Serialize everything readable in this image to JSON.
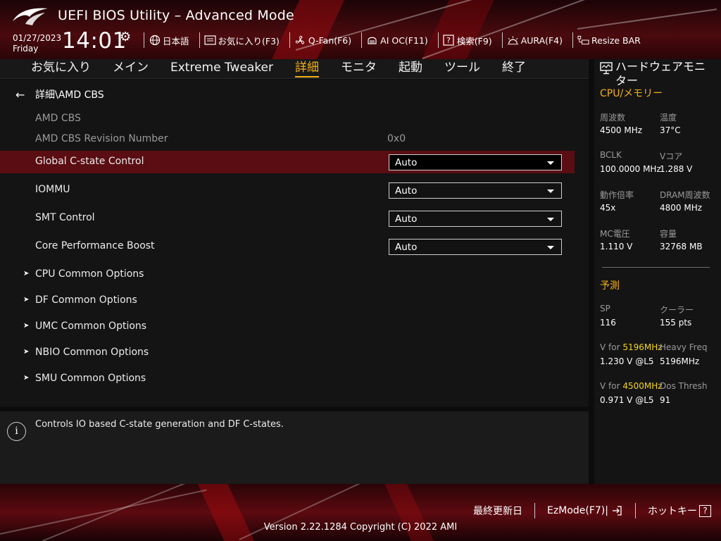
{
  "header": {
    "title": "UEFI BIOS Utility – Advanced Mode",
    "date": "01/27/2023",
    "weekday": "Friday",
    "time": "14:01",
    "toolbar": [
      {
        "label": "日本語",
        "icon": "globe-icon"
      },
      {
        "label": "お気に入り(F3)",
        "icon": "favorites-icon"
      },
      {
        "label": "Q-Fan(F6)",
        "icon": "fan-icon"
      },
      {
        "label": "AI OC(F11)",
        "icon": "ai-oc-icon"
      },
      {
        "label": "検索(F9)",
        "icon": "help-search-icon"
      },
      {
        "label": "AURA(F4)",
        "icon": "aura-icon"
      },
      {
        "label": "Resize BAR",
        "icon": "resize-bar-icon"
      }
    ]
  },
  "tabs": [
    {
      "label": "お気に入り",
      "active": false
    },
    {
      "label": "メイン",
      "active": false
    },
    {
      "label": "Extreme Tweaker",
      "active": false
    },
    {
      "label": "詳細",
      "active": true
    },
    {
      "label": "モニタ",
      "active": false
    },
    {
      "label": "起動",
      "active": false
    },
    {
      "label": "ツール",
      "active": false
    },
    {
      "label": "終了",
      "active": false
    }
  ],
  "main": {
    "breadcrumb": "詳細\\AMD CBS",
    "section_title": "AMD CBS",
    "revision_label": "AMD CBS Revision Number",
    "revision_value": "0x0",
    "settings": [
      {
        "label": "Global C-state Control",
        "value": "Auto",
        "selected": true
      },
      {
        "label": "IOMMU",
        "value": "Auto",
        "selected": false
      },
      {
        "label": "SMT Control",
        "value": "Auto",
        "selected": false
      },
      {
        "label": "Core Performance Boost",
        "value": "Auto",
        "selected": false
      }
    ],
    "submenus": [
      "CPU Common Options",
      "DF Common Options",
      "UMC Common Options",
      "NBIO Common Options",
      "SMU Common Options"
    ]
  },
  "help": {
    "text": "Controls IO based C-state generation and DF C-states."
  },
  "hw_monitor": {
    "title": "ハードウェアモニター",
    "cpu_section": "CPU/メモリー",
    "cpu_items": [
      {
        "label": "周波数",
        "value": "4500 MHz"
      },
      {
        "label": "温度",
        "value": "37°C"
      },
      {
        "label": "BCLK",
        "value": "100.0000 MHz"
      },
      {
        "label": "Vコア",
        "value": "1.288 V"
      },
      {
        "label": "動作倍率",
        "value": "45x"
      },
      {
        "label": "DRAM周波数",
        "value": "4800 MHz"
      },
      {
        "label": "MC電圧",
        "value": "1.110 V"
      },
      {
        "label": "容量",
        "value": "32768 MB"
      }
    ],
    "pred_section": "予測",
    "pred_items": [
      {
        "label": "SP",
        "value": "116"
      },
      {
        "label": "クーラー",
        "value": "155 pts"
      }
    ],
    "vfor": [
      {
        "prefix": "V for ",
        "freq": "5196MHz",
        "value": "1.230 V @L5",
        "label2": "Heavy Freq",
        "value2": "5196MHz"
      },
      {
        "prefix": "V for ",
        "freq": "4500MHz",
        "value": "0.971 V @L5",
        "label2": "Dos Thresh",
        "value2": "91"
      }
    ]
  },
  "footer": {
    "last_modified": "最終更新日",
    "ezmode": "EzMode(F7)|",
    "hotkeys": "ホットキー",
    "hotkey_glyph": "?",
    "version": "Version 2.22.1284 Copyright (C) 2022 AMI"
  },
  "colors": {
    "accent": "#f5b018",
    "highlight_row": "#5a0d12",
    "freq_highlight": "#f5d418"
  }
}
